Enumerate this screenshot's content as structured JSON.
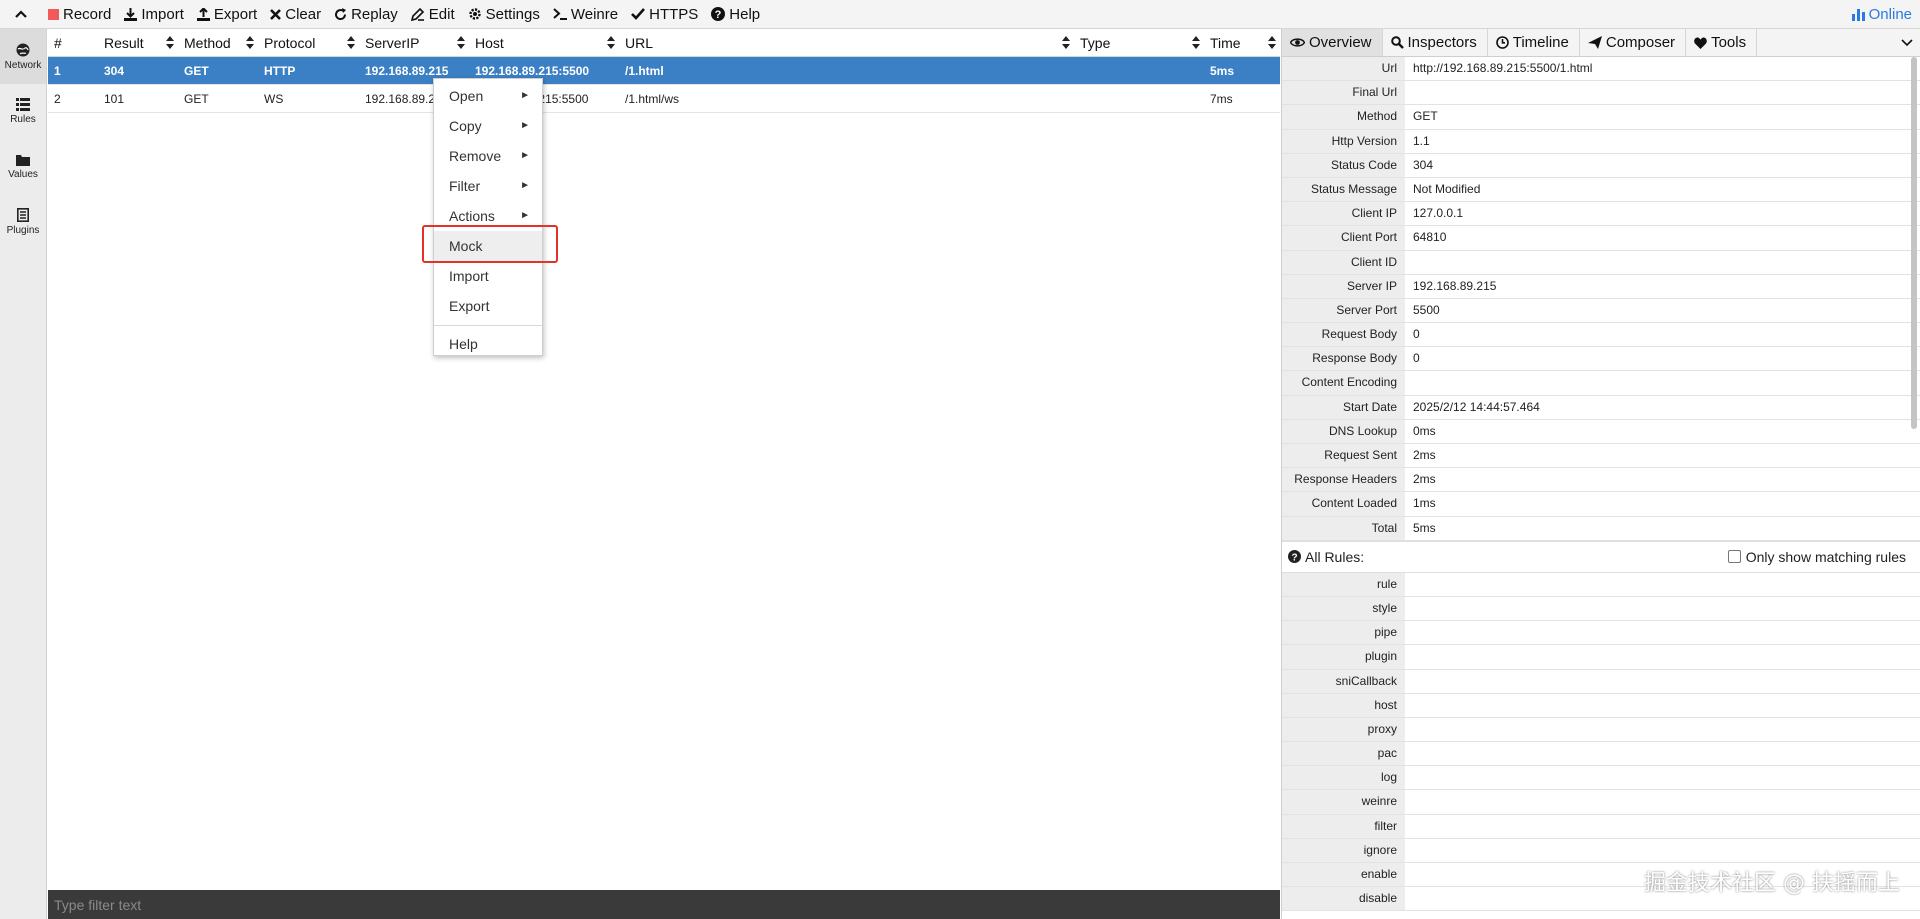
{
  "toolbar": {
    "record": "Record",
    "import": "Import",
    "export": "Export",
    "clear": "Clear",
    "replay": "Replay",
    "edit": "Edit",
    "settings": "Settings",
    "weinre": "Weinre",
    "https": "HTTPS",
    "help": "Help",
    "online": "Online",
    "record_color": "#f05a5a",
    "online_color": "#2a7ae2"
  },
  "sidebar": {
    "items": [
      {
        "label": "Network",
        "icon": "globe-icon"
      },
      {
        "label": "Rules",
        "icon": "list-icon"
      },
      {
        "label": "Values",
        "icon": "folder-icon"
      },
      {
        "label": "Plugins",
        "icon": "document-icon"
      }
    ]
  },
  "table": {
    "columns": [
      "#",
      "Result",
      "Method",
      "Protocol",
      "ServerIP",
      "Host",
      "URL",
      "Type",
      "Time"
    ],
    "rows": [
      {
        "num": "1",
        "result": "304",
        "method": "GET",
        "protocol": "HTTP",
        "server_ip": "192.168.89.215",
        "host": "192.168.89.215:5500",
        "url": "/1.html",
        "type": "",
        "time": "5ms",
        "selected": true
      },
      {
        "num": "2",
        "result": "101",
        "method": "GET",
        "protocol": "WS",
        "server_ip": "192.168.89.215",
        "host": "192.168.89.215:5500",
        "url": "/1.html/ws",
        "type": "",
        "time": "7ms",
        "selected": false
      }
    ],
    "selected_color": "#3b7fc4"
  },
  "filter": {
    "placeholder": "Type filter text"
  },
  "context_menu": {
    "items": [
      {
        "label": "Open",
        "submenu": true
      },
      {
        "label": "Copy",
        "submenu": true
      },
      {
        "label": "Remove",
        "submenu": true
      },
      {
        "label": "Filter",
        "submenu": true
      },
      {
        "label": "Actions",
        "submenu": true
      },
      {
        "label": "Mock",
        "submenu": false,
        "highlighted": true
      },
      {
        "label": "Import",
        "submenu": false
      },
      {
        "label": "Export",
        "submenu": false
      },
      {
        "label": "Help",
        "submenu": false
      }
    ],
    "highlight_color": "#e2332a"
  },
  "right_panel": {
    "tabs": [
      {
        "label": "Overview",
        "icon": "eye-icon",
        "active": true
      },
      {
        "label": "Inspectors",
        "icon": "search-icon"
      },
      {
        "label": "Timeline",
        "icon": "clock-icon"
      },
      {
        "label": "Composer",
        "icon": "send-icon"
      },
      {
        "label": "Tools",
        "icon": "heart-icon"
      }
    ],
    "overview": [
      {
        "key": "Url",
        "value": "http://192.168.89.215:5500/1.html"
      },
      {
        "key": "Final Url",
        "value": ""
      },
      {
        "key": "Method",
        "value": "GET"
      },
      {
        "key": "Http Version",
        "value": "1.1"
      },
      {
        "key": "Status Code",
        "value": "304"
      },
      {
        "key": "Status Message",
        "value": "Not Modified"
      },
      {
        "key": "Client IP",
        "value": "127.0.0.1"
      },
      {
        "key": "Client Port",
        "value": "64810"
      },
      {
        "key": "Client ID",
        "value": ""
      },
      {
        "key": "Server IP",
        "value": "192.168.89.215"
      },
      {
        "key": "Server Port",
        "value": "5500"
      },
      {
        "key": "Request Body",
        "value": "0"
      },
      {
        "key": "Response Body",
        "value": "0"
      },
      {
        "key": "Content Encoding",
        "value": ""
      },
      {
        "key": "Start Date",
        "value": "2025/2/12 14:44:57.464"
      },
      {
        "key": "DNS Lookup",
        "value": "0ms"
      },
      {
        "key": "Request Sent",
        "value": "2ms"
      },
      {
        "key": "Response Headers",
        "value": "2ms"
      },
      {
        "key": "Content Loaded",
        "value": "1ms"
      },
      {
        "key": "Total",
        "value": "5ms"
      }
    ],
    "all_rules_label": "All Rules:",
    "only_matching_label": "Only show matching rules",
    "rules": [
      "rule",
      "style",
      "pipe",
      "plugin",
      "sniCallback",
      "host",
      "proxy",
      "pac",
      "log",
      "weinre",
      "filter",
      "ignore",
      "enable",
      "disable"
    ]
  },
  "watermark": "掘金技术社区 @ 扶摇而上"
}
